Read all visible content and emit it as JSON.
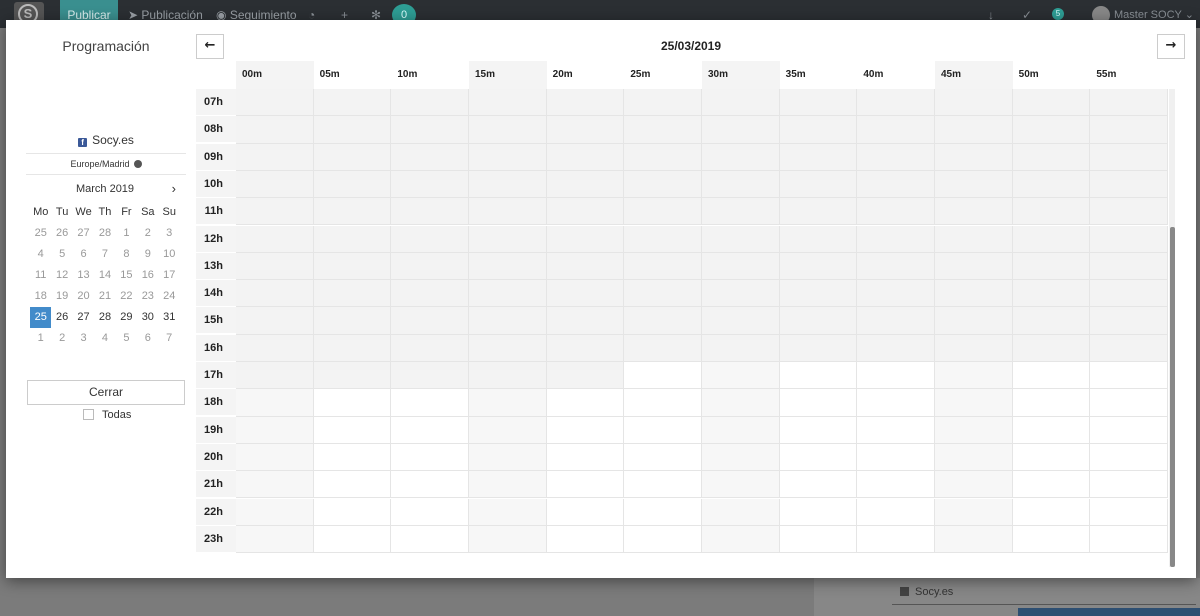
{
  "app": {
    "nav": {
      "publicar": "Publicar",
      "publicacion": "Publicación",
      "seguimiento": "Seguimiento",
      "badge": "0",
      "small_badge": "5",
      "user": "Master SOCY"
    },
    "bg_account": "Socy.es"
  },
  "sidebar": {
    "title": "Programación",
    "account": "Socy.es",
    "timezone": "Europe/Madrid",
    "calendar": {
      "month": "March 2019",
      "weekdays": [
        "Mo",
        "Tu",
        "We",
        "Th",
        "Fr",
        "Sa",
        "Su"
      ],
      "weeks": [
        [
          {
            "d": "25",
            "m": true
          },
          {
            "d": "26",
            "m": true
          },
          {
            "d": "27",
            "m": true
          },
          {
            "d": "28",
            "m": true
          },
          {
            "d": "1",
            "m": true
          },
          {
            "d": "2",
            "m": true
          },
          {
            "d": "3",
            "m": true
          }
        ],
        [
          {
            "d": "4",
            "m": true
          },
          {
            "d": "5",
            "m": true
          },
          {
            "d": "6",
            "m": true
          },
          {
            "d": "7",
            "m": true
          },
          {
            "d": "8",
            "m": true
          },
          {
            "d": "9",
            "m": true
          },
          {
            "d": "10",
            "m": true
          }
        ],
        [
          {
            "d": "11",
            "m": true
          },
          {
            "d": "12",
            "m": true
          },
          {
            "d": "13",
            "m": true
          },
          {
            "d": "14",
            "m": true
          },
          {
            "d": "15",
            "m": true
          },
          {
            "d": "16",
            "m": true
          },
          {
            "d": "17",
            "m": true
          }
        ],
        [
          {
            "d": "18",
            "m": true
          },
          {
            "d": "19",
            "m": true
          },
          {
            "d": "20",
            "m": true
          },
          {
            "d": "21",
            "m": true
          },
          {
            "d": "22",
            "m": true
          },
          {
            "d": "23",
            "m": true
          },
          {
            "d": "24",
            "m": true
          }
        ],
        [
          {
            "d": "25",
            "s": true
          },
          {
            "d": "26"
          },
          {
            "d": "27"
          },
          {
            "d": "28"
          },
          {
            "d": "29"
          },
          {
            "d": "30"
          },
          {
            "d": "31"
          }
        ],
        [
          {
            "d": "1",
            "m": true
          },
          {
            "d": "2",
            "m": true
          },
          {
            "d": "3",
            "m": true
          },
          {
            "d": "4",
            "m": true
          },
          {
            "d": "5",
            "m": true
          },
          {
            "d": "6",
            "m": true
          },
          {
            "d": "7",
            "m": true
          }
        ]
      ]
    },
    "close_label": "Cerrar",
    "all_label": "Todas"
  },
  "schedule": {
    "date": "25/03/2019",
    "minutes": [
      "00m",
      "05m",
      "10m",
      "15m",
      "20m",
      "25m",
      "30m",
      "35m",
      "40m",
      "45m",
      "50m",
      "55m"
    ],
    "hours": [
      "07h",
      "08h",
      "09h",
      "10h",
      "11h",
      "12h",
      "13h",
      "14h",
      "15h",
      "16h",
      "17h",
      "18h",
      "19h",
      "20h",
      "21h",
      "22h",
      "23h"
    ],
    "current_slot": {
      "hour": "17h",
      "minute": "25m"
    }
  },
  "colors": {
    "selected_day": "#428bca",
    "past_slot": "#f3f3f3",
    "accent_nav": "#3a8f8f"
  }
}
